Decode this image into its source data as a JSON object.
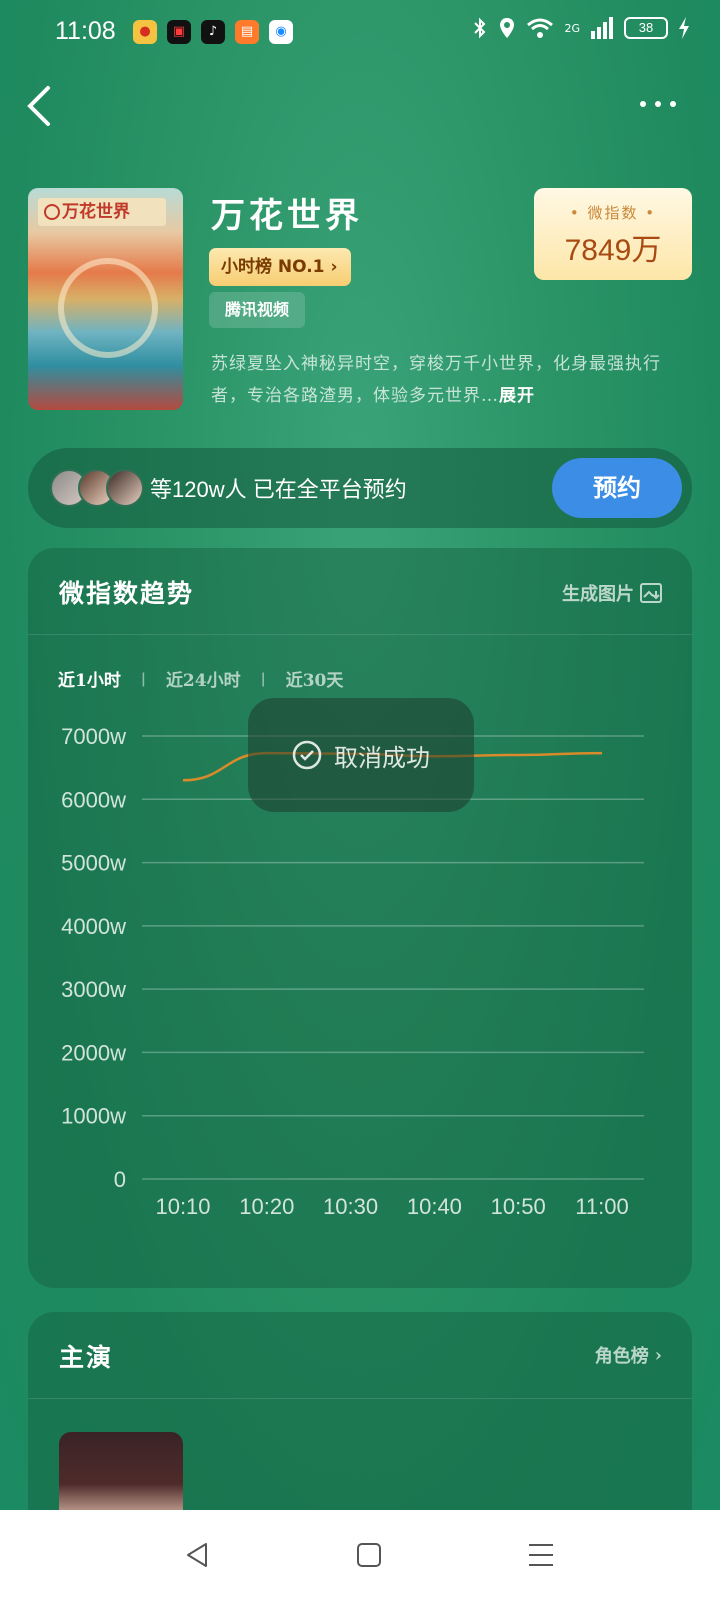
{
  "status_bar": {
    "time": "11:08",
    "battery": "38",
    "network": "2G",
    "app_icons": [
      "weibo-icon",
      "video-icon",
      "tiktok-icon",
      "app-icon",
      "map-icon"
    ]
  },
  "movie": {
    "title": "万花世界",
    "rank_badge": "小时榜 NO.1",
    "platform": "腾讯视频",
    "description": "苏绿夏坠入神秘异时空，穿梭万千小世界，化身最强执行者，专治各路渣男，体验多元世界…",
    "expand_label": "展开",
    "poster_title": "万花世界"
  },
  "weizhishu": {
    "label": "• 微指数 •",
    "value": "7849万"
  },
  "reservation": {
    "text": "等120w人 已在全平台预约",
    "button": "预约"
  },
  "trend": {
    "title": "微指数趋势",
    "action": "生成图片",
    "tabs": [
      "近1小时",
      "近24小时",
      "近30天"
    ],
    "active_tab": 0
  },
  "toast": {
    "text": "取消成功"
  },
  "cast": {
    "title": "主演",
    "action": "角色榜"
  },
  "colors": {
    "line": "#d98a2b",
    "reserve_button": "#3b8de6",
    "badge": "#f7cd72"
  },
  "chart_data": {
    "type": "line",
    "x": [
      "10:10",
      "10:20",
      "10:30",
      "10:40",
      "10:50",
      "11:00"
    ],
    "series": [
      {
        "values": [
          6300,
          6730,
          6720,
          6680,
          6700,
          6730
        ]
      }
    ],
    "y_tick_labels": [
      "0",
      "1000w",
      "2000w",
      "3000w",
      "4000w",
      "5000w",
      "6000w",
      "7000w"
    ],
    "ylim": [
      0,
      7000
    ],
    "grid": true
  }
}
